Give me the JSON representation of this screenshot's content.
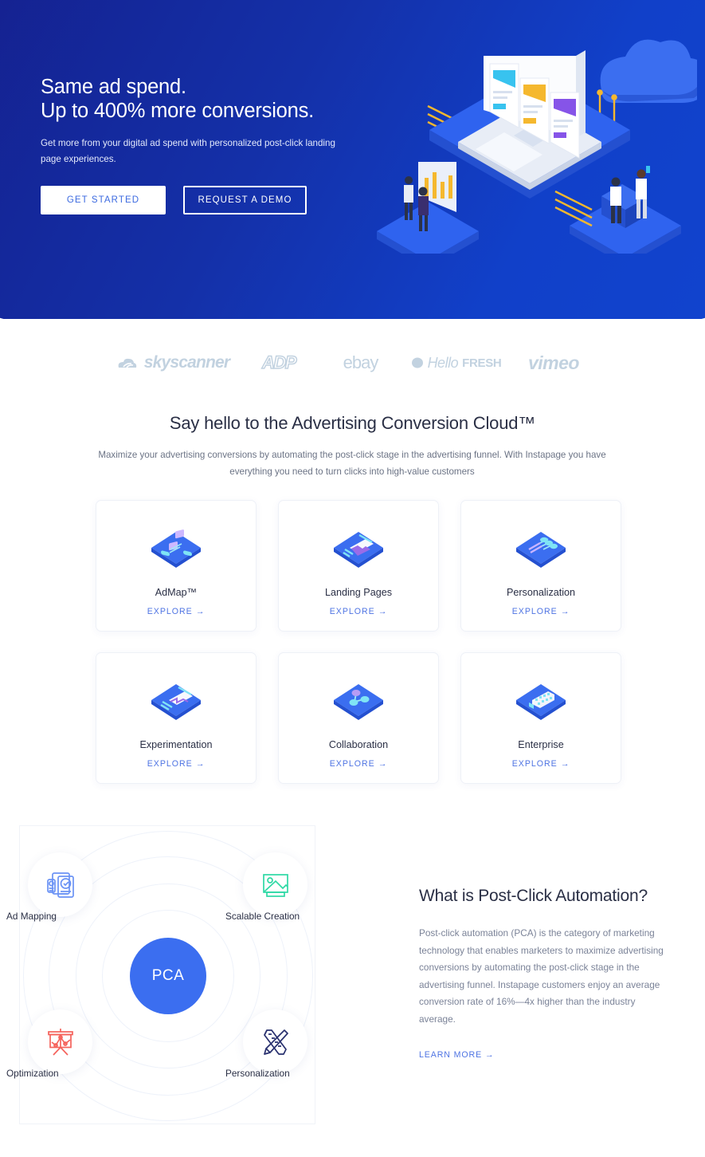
{
  "hero": {
    "headline_line1": "Same ad spend.",
    "headline_line2": "Up to 400% more conversions.",
    "subtext": "Get more from your digital ad spend with personalized post-click landing page experiences.",
    "primary_button": "GET STARTED",
    "secondary_button": "REQUEST A DEMO",
    "bg_color_start": "#151e8b",
    "bg_color_end": "#1144cf",
    "illustration": "isometric-laptop-cloud-analytics-illustration"
  },
  "logos": [
    {
      "name": "skyscanner",
      "label": "skyscanner"
    },
    {
      "name": "adp",
      "label": "ADP"
    },
    {
      "name": "ebay",
      "label": "ebay"
    },
    {
      "name": "hellofresh",
      "label_a": "Hello",
      "label_b": "FRESH"
    },
    {
      "name": "vimeo",
      "label": "vimeo"
    }
  ],
  "features": {
    "title": "Say hello to the Advertising Conversion Cloud™",
    "subtitle": "Maximize your advertising conversions by automating the post-click stage in the advertising funnel. With Instapage you have everything you need to turn clicks into high-value customers",
    "cta_label": "EXPLORE →",
    "cards": [
      {
        "label": "AdMap™",
        "icon": "admap-isometric-icon",
        "cta": "EXPLORE →"
      },
      {
        "label": "Landing Pages",
        "icon": "landing-pages-isometric-icon",
        "cta": "EXPLORE →"
      },
      {
        "label": "Personalization",
        "icon": "personalization-isometric-icon",
        "cta": "EXPLORE →"
      },
      {
        "label": "Experimentation",
        "icon": "experimentation-isometric-icon",
        "cta": "EXPLORE →"
      },
      {
        "label": "Collaboration",
        "icon": "collaboration-isometric-icon",
        "cta": "EXPLORE →"
      },
      {
        "label": "Enterprise",
        "icon": "enterprise-isometric-icon",
        "cta": "EXPLORE →"
      }
    ]
  },
  "pca": {
    "center_label": "PCA",
    "nodes": [
      {
        "label": "Ad Mapping",
        "icon": "ad-mapping-documents-icon",
        "color": "#6b93f5"
      },
      {
        "label": "Scalable Creation",
        "icon": "scalable-creation-image-icon",
        "color": "#2ed9a5"
      },
      {
        "label": "Optimization",
        "icon": "optimization-presentation-chart-icon",
        "color": "#f5635c"
      },
      {
        "label": "Personalization",
        "icon": "personalization-pencil-ruler-icon",
        "color": "#28306e"
      }
    ],
    "heading": "What is Post-Click Automation?",
    "body": "Post-click automation (PCA) is the category of marketing technology that enables marketers to maximize advertising conversions by automating the post-click stage in the advertising funnel. Instapage customers enjoy an average conversion rate of 16%—4x higher than the industry average.",
    "cta": "LEARN MORE →",
    "accent_color": "#3b6ef0"
  }
}
